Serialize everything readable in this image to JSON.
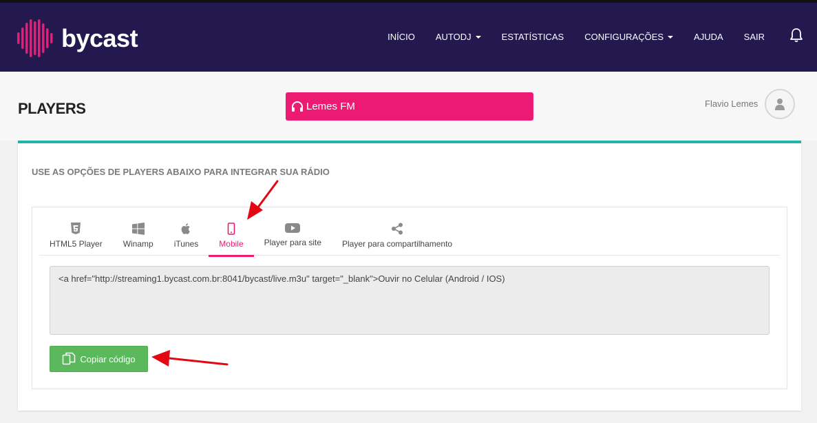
{
  "brand": {
    "name": "bycast",
    "accent": "#ec1a73",
    "nav_bg": "#23194f",
    "card_accent": "#23b3a8"
  },
  "nav": {
    "items": [
      {
        "label": "INÍCIO",
        "dropdown": false
      },
      {
        "label": "AUTODJ",
        "dropdown": true
      },
      {
        "label": "ESTATÍSTICAS",
        "dropdown": false
      },
      {
        "label": "CONFIGURAÇÕES",
        "dropdown": true
      },
      {
        "label": "AJUDA",
        "dropdown": false
      },
      {
        "label": "SAIR",
        "dropdown": false
      }
    ],
    "bell_icon": "bell-icon"
  },
  "header": {
    "title": "PLAYERS",
    "radio_name": "Lemes FM",
    "radio_icon": "headphones-icon",
    "user_name": "Flavio Lemes",
    "avatar_icon": "user-icon"
  },
  "card": {
    "subtitle": "USE AS OPÇÕES DE PLAYERS ABAIXO PARA INTEGRAR SUA RÁDIO",
    "tabs": [
      {
        "label": "HTML5 Player",
        "icon": "html5-icon",
        "active": false
      },
      {
        "label": "Winamp",
        "icon": "windows-icon",
        "active": false
      },
      {
        "label": "iTunes",
        "icon": "apple-icon",
        "active": false
      },
      {
        "label": "Mobile",
        "icon": "mobile-icon",
        "active": true
      },
      {
        "label": "Player para site",
        "icon": "youtube-icon",
        "active": false
      },
      {
        "label": "Player para compartilhamento",
        "icon": "share-icon",
        "active": false
      }
    ],
    "code": "<a href=\"http://streaming1.bycast.com.br:8041/bycast/live.m3u\" target=\"_blank\">Ouvir no Celular (Android / IOS)",
    "copy_label": "Copiar código",
    "copy_icon": "copy-icon"
  }
}
